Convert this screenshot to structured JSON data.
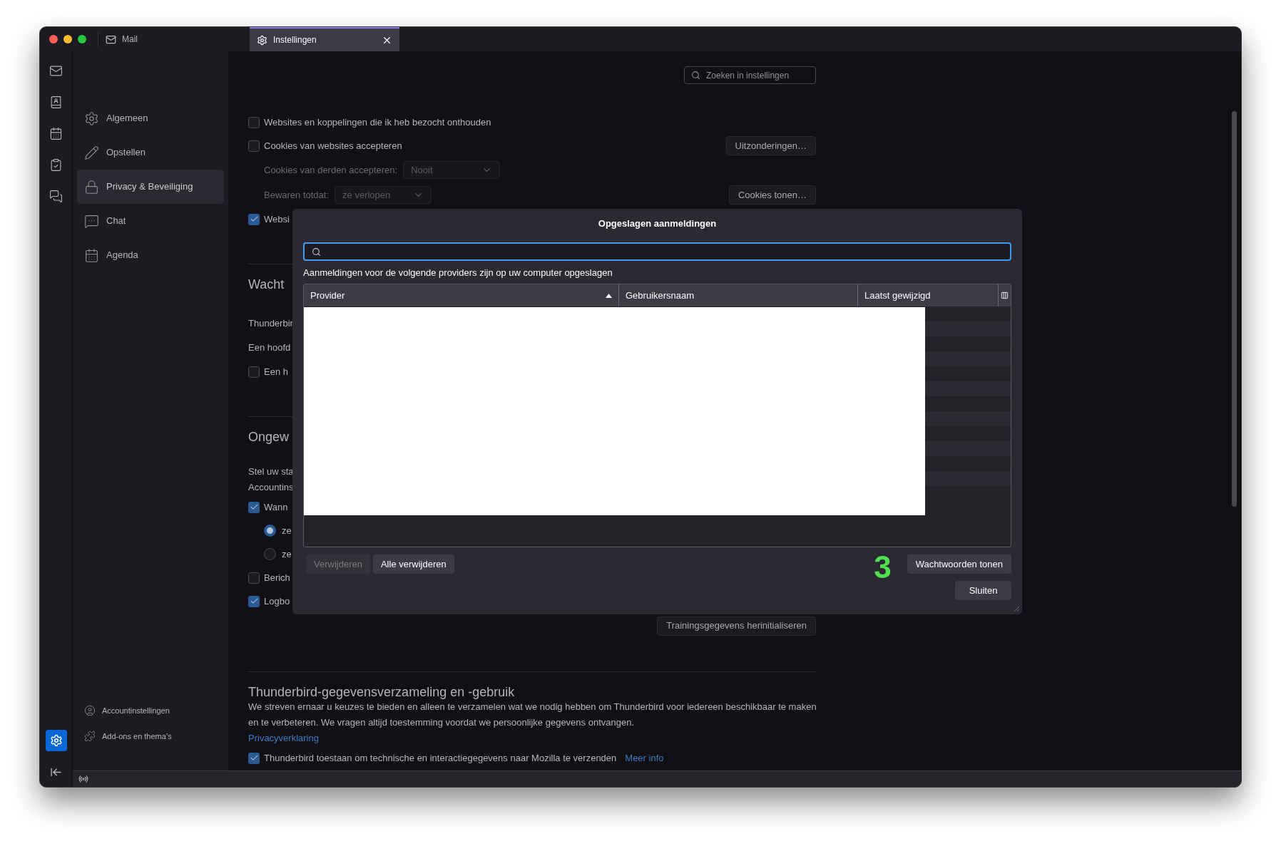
{
  "tabs": [
    {
      "label": "Mail",
      "selected": false
    },
    {
      "label": "Instellingen",
      "selected": true
    }
  ],
  "rail": {
    "items": [
      {
        "selected": false
      },
      {
        "selected": false
      },
      {
        "selected": false
      },
      {
        "selected": false
      },
      {
        "selected": false
      }
    ],
    "settings": {
      "selected": true
    }
  },
  "sidebar": {
    "items": [
      {
        "label": "Algemeen",
        "selected": false
      },
      {
        "label": "Opstellen",
        "selected": false
      },
      {
        "label": "Privacy & Beveiliging",
        "selected": true
      },
      {
        "label": "Chat",
        "selected": false
      },
      {
        "label": "Agenda",
        "selected": false
      }
    ],
    "footer": [
      {
        "label": "Accountinstellingen"
      },
      {
        "label": "Add-ons en thema’s"
      }
    ]
  },
  "settings": {
    "search": {
      "placeholder": "Zoeken in instellingen"
    },
    "rows": [
      {
        "kind": "checkbox",
        "label": "Websites en koppelingen die ik heb bezocht onthouden",
        "checked": false
      },
      {
        "kind": "checkbox",
        "label": "Cookies van websites accepteren",
        "checked": false,
        "button": "Uitzonderingen…"
      },
      {
        "kind": "select",
        "label": "Cookies van derden accepteren:",
        "value": "Nooit",
        "disabled": true
      },
      {
        "kind": "select",
        "label": "Bewaren totdat:",
        "value": "ze verlopen",
        "disabled": true,
        "button": "Cookies tonen…"
      },
      {
        "kind": "checkbox",
        "label": "Websi",
        "checked": true
      },
      {
        "kind": "divider"
      },
      {
        "kind": "heading",
        "label": "Wacht"
      },
      {
        "kind": "text",
        "label": "Thunderbir"
      },
      {
        "kind": "text",
        "label": "Een hoofd"
      },
      {
        "kind": "checkbox",
        "label": "Een h",
        "checked": false
      },
      {
        "kind": "divider"
      },
      {
        "kind": "heading",
        "label": "Ongew"
      },
      {
        "kind": "text",
        "lines": [
          "Stel uw sta",
          "Accountins"
        ]
      },
      {
        "kind": "checkbox",
        "label": "Wann",
        "checked": true
      },
      {
        "kind": "radio",
        "label": "ze",
        "selected": true
      },
      {
        "kind": "radio",
        "label": "ze",
        "selected": false
      },
      {
        "kind": "checkbox",
        "label": "Berich",
        "checked": false
      },
      {
        "kind": "checkbox",
        "label": "Logbo",
        "checked": true
      },
      {
        "kind": "button",
        "label": "Trainingsgegevens herinitialiseren"
      },
      {
        "kind": "divider"
      },
      {
        "kind": "heading",
        "label": "Thunderbird-gegevensverzameling en -gebruik"
      },
      {
        "kind": "paragraph",
        "lines": [
          "We streven ernaar u keuzes te bieden en alleen te verzamelen wat we nodig hebben om Thunderbird voor iedereen beschikbaar te maken",
          "en te verbeteren. We vragen altijd toestemming voordat we persoonlijke gegevens ontvangen."
        ]
      },
      {
        "kind": "link",
        "label": "Privacyverklaring"
      },
      {
        "kind": "checkbox",
        "label": "Thunderbird toestaan om technische en interactiegegevens naar Mozilla te verzenden",
        "checked": true,
        "link": "Meer info"
      }
    ]
  },
  "dialog": {
    "title": "Opgeslagen aanmeldingen",
    "search": {
      "focused": true
    },
    "description": "Aanmeldingen voor de volgende providers zijn op uw computer opgeslagen",
    "table": {
      "columns": [
        {
          "label": "Provider",
          "sorted": true
        },
        {
          "label": "Gebruikersnaam",
          "sorted": false
        },
        {
          "label": "Laatst gewijzigd",
          "sorted": false
        }
      ]
    },
    "buttons": [
      {
        "label": "Verwijderen",
        "disabled": true
      },
      {
        "label": "Alle verwijderen",
        "disabled": false
      }
    ],
    "step_marker": "3",
    "show_passwords_button": "Wachtwoorden tonen",
    "close_button": "Sluiten"
  }
}
